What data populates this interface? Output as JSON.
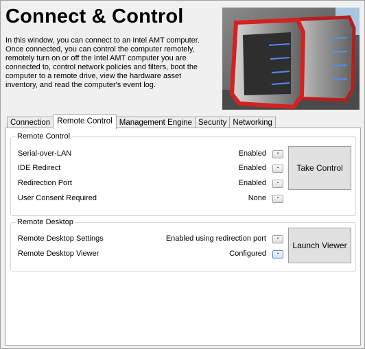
{
  "header": {
    "title": "Connect & Control",
    "description": "In this window, you can connect to an Intel AMT computer. Once connected, you can control the computer remotely, remotely turn on or off the Intel AMT computer you are connected to, control network policies and filters, boot the computer to a remote drive, view the hardware asset inventory, and read the computer's event log."
  },
  "tabs": [
    {
      "label": "Connection"
    },
    {
      "label": "Remote Control"
    },
    {
      "label": "Management Engine"
    },
    {
      "label": "Security"
    },
    {
      "label": "Networking"
    }
  ],
  "active_tab": "Remote Control",
  "remote_control": {
    "title": "Remote Control",
    "rows": [
      {
        "label": "Serial-over-LAN",
        "value": "Enabled"
      },
      {
        "label": "IDE Redirect",
        "value": "Enabled"
      },
      {
        "label": "Redirection Port",
        "value": "Enabled"
      },
      {
        "label": "User Consent Required",
        "value": "None"
      }
    ],
    "button_label": "Take Control"
  },
  "remote_desktop": {
    "title": "Remote Desktop",
    "rows": [
      {
        "label": "Remote Desktop Settings",
        "value": "Enabled using redirection port"
      },
      {
        "label": "Remote Desktop Viewer",
        "value": "Configured"
      }
    ],
    "button_label": "Launch Viewer"
  },
  "dropdown_glyph": "▪"
}
